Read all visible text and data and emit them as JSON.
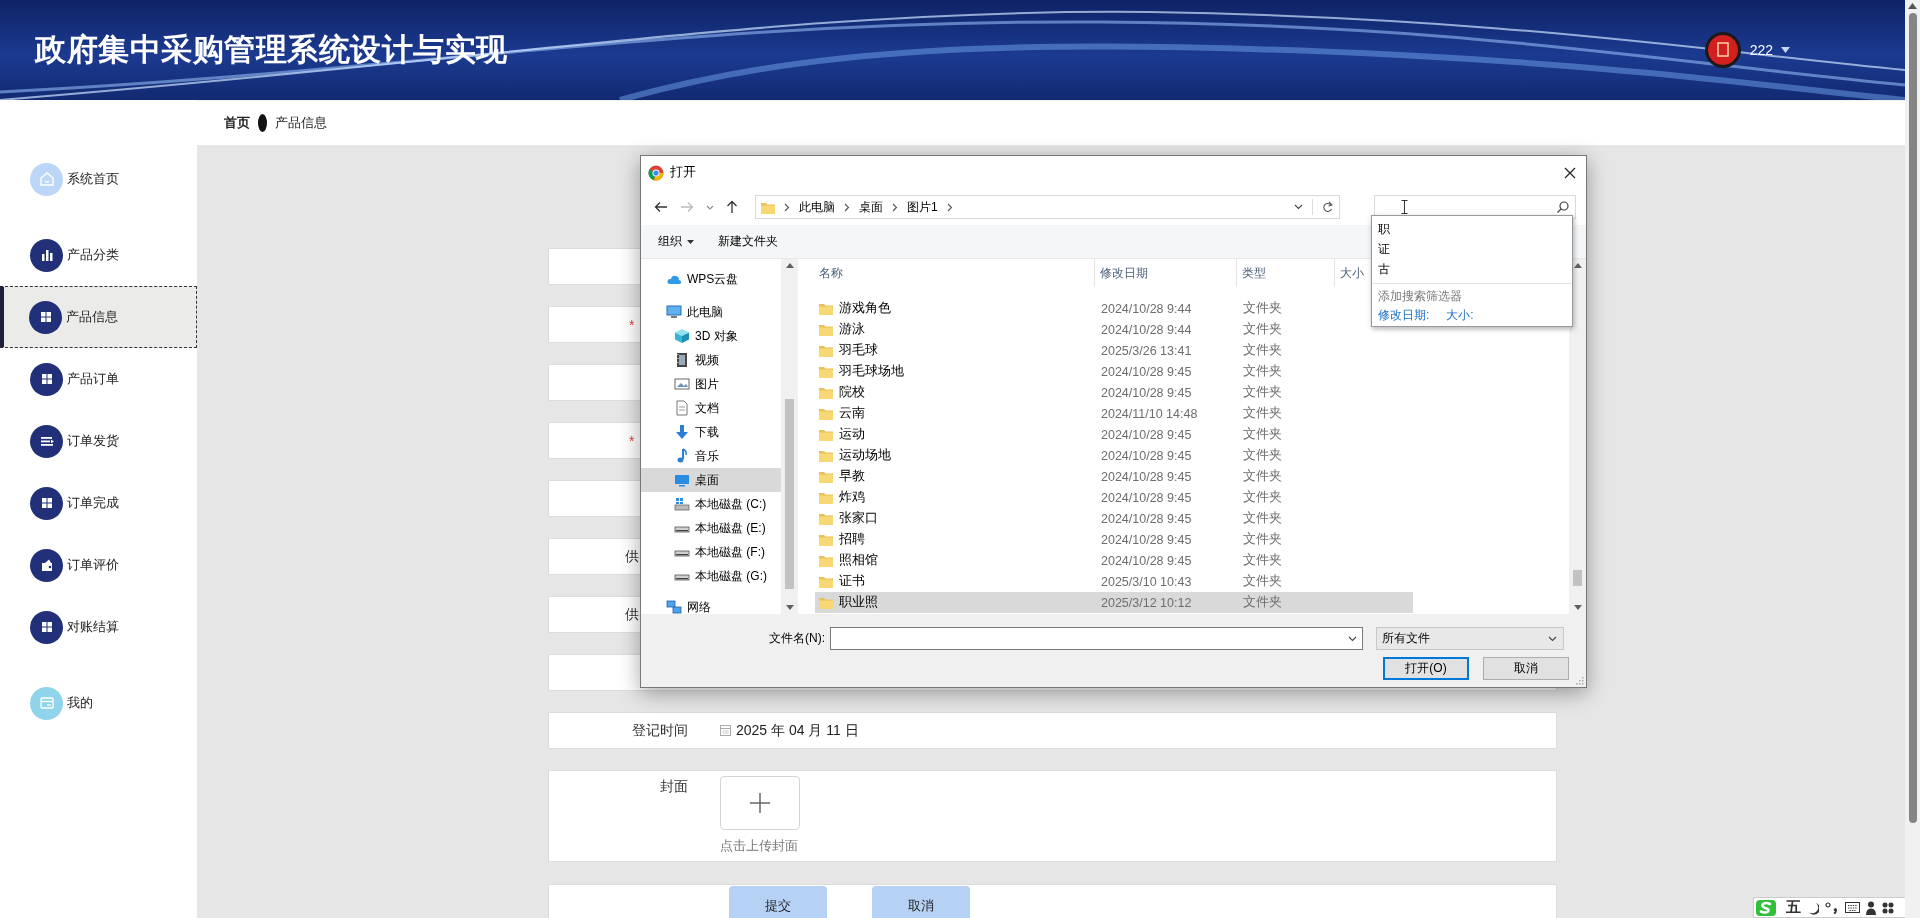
{
  "header": {
    "title": "政府集中采购管理系统设计与实现",
    "user": "222"
  },
  "breadcrumb": [
    "首页",
    "产品信息"
  ],
  "sidebar": {
    "items": [
      {
        "label": "系统首页",
        "kind": "home",
        "color": "#bcd6f7",
        "selected": false
      },
      {
        "label": "产品分类",
        "kind": "chart",
        "color": "#213079",
        "selected": false
      },
      {
        "label": "产品信息",
        "kind": "grid",
        "color": "#213079",
        "selected": true
      },
      {
        "label": "产品订单",
        "kind": "grid",
        "color": "#213079",
        "selected": false
      },
      {
        "label": "订单发货",
        "kind": "list",
        "color": "#213079",
        "selected": false
      },
      {
        "label": "订单完成",
        "kind": "grid",
        "color": "#213079",
        "selected": false
      },
      {
        "label": "订单评价",
        "kind": "wallet",
        "color": "#213079",
        "selected": false
      },
      {
        "label": "对账结算",
        "kind": "grid",
        "color": "#213079",
        "selected": false
      },
      {
        "label": "我的",
        "kind": "card",
        "color": "#8fd4eb",
        "selected": false
      }
    ]
  },
  "form": {
    "rows": [
      {
        "kind": "blank"
      },
      {
        "kind": "required",
        "label": "*"
      },
      {
        "kind": "blank"
      },
      {
        "kind": "required",
        "label": "*"
      },
      {
        "kind": "blank"
      },
      {
        "kind": "partial",
        "label": "供"
      },
      {
        "kind": "partial",
        "label": "供"
      },
      {
        "kind": "blank"
      },
      {
        "kind": "date",
        "label": "登记时间",
        "value": "2025 年 04 月 11 日"
      },
      {
        "kind": "upload",
        "label": "封面",
        "hint": "点击上传封面"
      },
      {
        "kind": "actions",
        "buttons": [
          "提交",
          "取消"
        ]
      }
    ]
  },
  "dialog": {
    "title": "打开",
    "path": [
      "此电脑",
      "桌面",
      "图片1"
    ],
    "toolbar": [
      "组织",
      "新建文件夹"
    ],
    "nav": [
      {
        "label": "WPS云盘",
        "kind": "cloud",
        "selected": false
      },
      {
        "label": "此电脑",
        "kind": "pc",
        "selected": false,
        "children": [
          {
            "label": "3D 对象",
            "kind": "cube",
            "selected": false
          },
          {
            "label": "视频",
            "kind": "video",
            "selected": false
          },
          {
            "label": "图片",
            "kind": "image",
            "selected": false
          },
          {
            "label": "文档",
            "kind": "doc",
            "selected": false
          },
          {
            "label": "下载",
            "kind": "download",
            "selected": false
          },
          {
            "label": "音乐",
            "kind": "music",
            "selected": false
          },
          {
            "label": "桌面",
            "kind": "desktop",
            "selected": true
          },
          {
            "label": "本地磁盘 (C:)",
            "kind": "system-drive",
            "selected": false
          },
          {
            "label": "本地磁盘 (E:)",
            "kind": "drive",
            "selected": false
          },
          {
            "label": "本地磁盘 (F:)",
            "kind": "drive",
            "selected": false
          },
          {
            "label": "本地磁盘 (G:)",
            "kind": "drive",
            "selected": false
          }
        ]
      },
      {
        "label": "网络",
        "kind": "network",
        "selected": false
      }
    ],
    "columns": [
      "名称",
      "修改日期",
      "类型",
      "大小"
    ],
    "files": [
      {
        "name": "游戏角色",
        "modified": "2024/10/28 9:44",
        "type": "文件夹",
        "selected": false
      },
      {
        "name": "游泳",
        "modified": "2024/10/28 9:44",
        "type": "文件夹",
        "selected": false
      },
      {
        "name": "羽毛球",
        "modified": "2025/3/26 13:41",
        "type": "文件夹",
        "selected": false
      },
      {
        "name": "羽毛球场地",
        "modified": "2024/10/28 9:45",
        "type": "文件夹",
        "selected": false
      },
      {
        "name": "院校",
        "modified": "2024/10/28 9:45",
        "type": "文件夹",
        "selected": false
      },
      {
        "name": "云南",
        "modified": "2024/11/10 14:48",
        "type": "文件夹",
        "selected": false
      },
      {
        "name": "运动",
        "modified": "2024/10/28 9:45",
        "type": "文件夹",
        "selected": false
      },
      {
        "name": "运动场地",
        "modified": "2024/10/28 9:45",
        "type": "文件夹",
        "selected": false
      },
      {
        "name": "早教",
        "modified": "2024/10/28 9:45",
        "type": "文件夹",
        "selected": false
      },
      {
        "name": "炸鸡",
        "modified": "2024/10/28 9:45",
        "type": "文件夹",
        "selected": false
      },
      {
        "name": "张家口",
        "modified": "2024/10/28 9:45",
        "type": "文件夹",
        "selected": false
      },
      {
        "name": "招聘",
        "modified": "2024/10/28 9:45",
        "type": "文件夹",
        "selected": false
      },
      {
        "name": "照相馆",
        "modified": "2024/10/28 9:45",
        "type": "文件夹",
        "selected": false
      },
      {
        "name": "证书",
        "modified": "2025/3/10 10:43",
        "type": "文件夹",
        "selected": false
      },
      {
        "name": "职业照",
        "modified": "2025/3/12 10:12",
        "type": "文件夹",
        "selected": true
      }
    ],
    "file_name_label": "文件名(N):",
    "file_type": "所有文件",
    "buttons": [
      "打开(O)",
      "取消"
    ],
    "search": {
      "suggestions": [
        "职",
        "证",
        "古"
      ],
      "filter_hint": "添加搜索筛选器",
      "filters": [
        "修改日期:",
        "大小:"
      ]
    }
  },
  "ime": {
    "mode": "五"
  }
}
